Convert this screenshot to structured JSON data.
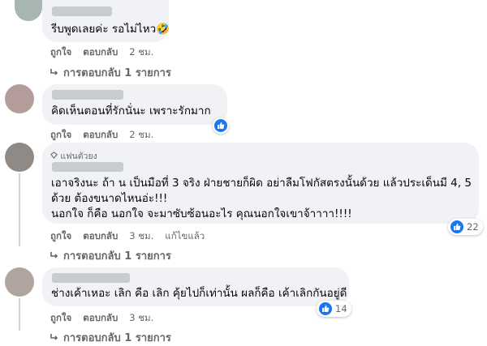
{
  "comments": [
    {
      "text": "รีบพูดเลยค่ะ รอไม่ไหว🤣",
      "actions": {
        "like": "ถูกใจ",
        "reply": "ตอบกลับ",
        "time": "2 ชม."
      },
      "replies": "การตอบกลับ 1 รายการ"
    },
    {
      "text": "คิดเห็นตอนที่รักนั่นะ เพราะรักมาก",
      "actions": {
        "like": "ถูกใจ",
        "reply": "ตอบกลับ",
        "time": "2 ชม."
      }
    },
    {
      "badge": "แฟนตัวยง",
      "lines": [
        "เอาจริงนะ ถ้า น เป็นมือที่ 3 จริง ฝ่ายชายก็ผิด อย่าลืมโฟกัสตรงนั้นด้วย แล้วประเด็นมี 4, 5",
        "ด้วย ต้องขนาดไหนอ่ะ!!!",
        "นอกใจ ก็คือ นอกใจ จะมาซับซ้อนอะไร คุณนอกใจเขาจ้าาาา!!!!"
      ],
      "reaction_count": "22",
      "actions": {
        "like": "ถูกใจ",
        "reply": "ตอบกลับ",
        "time": "3 ชม.",
        "edited": "แก้ไขแล้ว"
      },
      "replies": "การตอบกลับ 1 รายการ"
    },
    {
      "text": "ช่างเค้าเหอะ เลิก คือ เลิก คุ้ยไปก็เท่านั้น ผลก็คือ เค้าเลิกกันอยู่ดี",
      "reaction_count": "14",
      "actions": {
        "like": "ถูกใจ",
        "reply": "ตอบกลับ",
        "time": "3 ชม."
      },
      "replies": "การตอบกลับ 1 รายการ"
    }
  ],
  "colors": {
    "bubble": "#f0f2f5",
    "meta": "#65676b",
    "like_blue": "#1877f2"
  },
  "icons": {
    "like": "thumbs-up-icon",
    "reply_arrow": "reply-arrow-icon",
    "badge": "diamond-icon",
    "emoji": "rofl-emoji"
  }
}
